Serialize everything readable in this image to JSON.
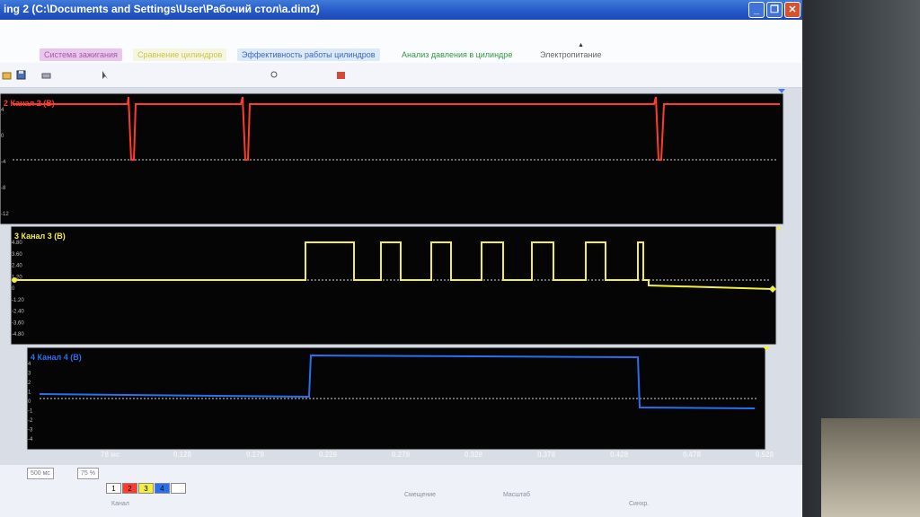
{
  "window": {
    "title": "ing 2 (C:\\Documents and Settings\\User\\Рабочий стол\\a.dim2)",
    "buttons": {
      "minimize": "_",
      "maximize": "❐",
      "close": "✕"
    }
  },
  "tabs": [
    {
      "label": "Система зажигания",
      "color": "#a35aa8"
    },
    {
      "label": "Сравнение цилиндров",
      "color": "#c7c74c"
    },
    {
      "label": "Эффективность работы цилиндров",
      "color": "#3c6ac1"
    },
    {
      "label": "Анализ давления в цилиндре",
      "color": "#2f9a3f"
    },
    {
      "label": "Электропитание",
      "color": "#666666"
    }
  ],
  "toolbar": {
    "icons": [
      "open-icon",
      "save-icon",
      "print-icon",
      "cursor-icon",
      "zoom-icon",
      "record-icon"
    ]
  },
  "scope": {
    "channels": [
      {
        "label": "2 Канал 2 (В)",
        "color": "#ff3b2f",
        "ticks": [
          "4",
          "0",
          "-4",
          "-8",
          "-12"
        ]
      },
      {
        "label": "3 Канал 3 (В)",
        "color": "#f3ee3f",
        "ticks": [
          "4.80",
          "3.60",
          "2.40",
          "1.20",
          "0",
          "-1.20",
          "-2.40",
          "-3.60",
          "-4.80"
        ]
      },
      {
        "label": "4 Канал 4 (В)",
        "color": "#2a6ff0",
        "ticks": [
          "4",
          "3",
          "2",
          "1",
          "0",
          "-1",
          "-2",
          "-3",
          "-4"
        ]
      }
    ],
    "time_labels": [
      "78 мс",
      "0.128",
      "0.178",
      "0.228",
      "0.278",
      "0.328",
      "0.378",
      "0.428",
      "0.478",
      "0.528"
    ]
  },
  "bottom": {
    "range_select": "500 мс",
    "zoom_select": "75 %",
    "channel_swatches": [
      "1",
      "2",
      "3",
      "4",
      ""
    ],
    "swatch_colors": [
      "#ffffff",
      "#ff3b2f",
      "#f3ee3f",
      "#2a6ff0",
      "#ffffff"
    ],
    "labels": [
      "Канал",
      "Смещение",
      "Масштаб",
      "Синхр."
    ]
  }
}
